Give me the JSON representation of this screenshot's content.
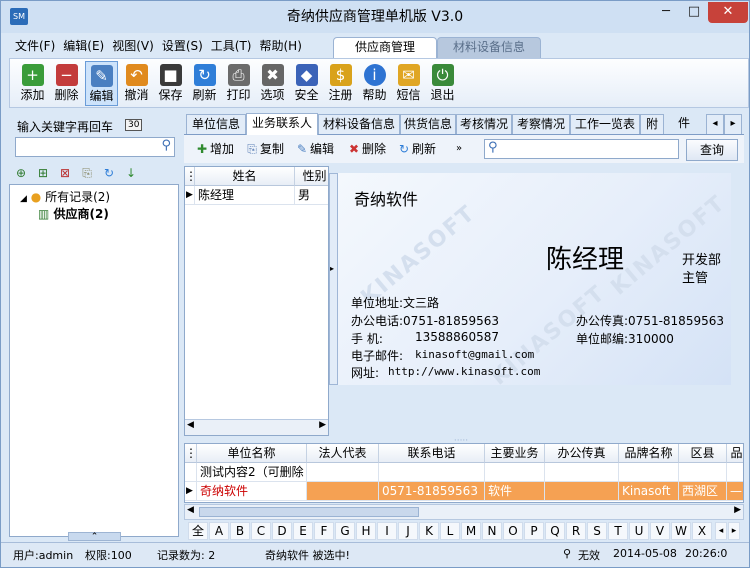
{
  "window": {
    "title": "奇纳供应商管理单机版 V3.0",
    "icon_text": "SM",
    "minimize": "─",
    "maximize": "□",
    "close": "✕"
  },
  "menu": [
    "文件(F)",
    "编辑(E)",
    "视图(V)",
    "设置(S)",
    "工具(T)",
    "帮助(H)"
  ],
  "ribbon_tabs": [
    "供应商管理",
    "材料设备信息"
  ],
  "toolbar": [
    {
      "label": "添加",
      "icon": "+",
      "color": "#3a9c3a"
    },
    {
      "label": "删除",
      "icon": "−",
      "color": "#c33c3c"
    },
    {
      "label": "编辑",
      "icon": "✎",
      "color": "#4a7fc1"
    },
    {
      "label": "撤消",
      "icon": "↶",
      "color": "#e08a1e"
    },
    {
      "label": "保存",
      "icon": "■",
      "color": "#3a3a3a"
    },
    {
      "label": "刷新",
      "icon": "↻",
      "color": "#2f7ed8"
    },
    {
      "label": "打印",
      "icon": "⎙",
      "color": "#6b6b6b"
    },
    {
      "label": "选项",
      "icon": "✖",
      "color": "#666666"
    },
    {
      "label": "安全",
      "icon": "◆",
      "color": "#3b63b8"
    },
    {
      "label": "注册",
      "icon": "$",
      "color": "#d9a21b"
    },
    {
      "label": "帮助",
      "icon": "i",
      "color": "#2e73d2"
    },
    {
      "label": "短信",
      "icon": "✉",
      "color": "#e0a624"
    },
    {
      "label": "退出",
      "icon": "⏻",
      "color": "#3a8a3a"
    }
  ],
  "left": {
    "search_label": "输入关键字再回车",
    "search_badge": "30",
    "search_value": "",
    "tools": [
      "⊕",
      "⊞",
      "⊠",
      "⎘",
      "↻",
      "↓"
    ],
    "tree_root": "所有记录(2)",
    "tree_child": "供应商(2)"
  },
  "detail_tabs": [
    "单位信息",
    "业务联系人",
    "材料设备信息",
    "供货信息",
    "考核情况",
    "考察情况",
    "工作一览表",
    "附",
    "件"
  ],
  "detail_toolbar": {
    "add": "增加",
    "copy": "复制",
    "edit": "编辑",
    "delete": "删除",
    "refresh": "刷新",
    "search_value": "",
    "query": "查询"
  },
  "contacts": {
    "columns": [
      "姓名",
      "性别"
    ],
    "rows": [
      {
        "name": "陈经理",
        "gender": "男"
      }
    ]
  },
  "card": {
    "company": "奇纳软件",
    "name": "陈经理",
    "dept": "开发部",
    "title": "主管",
    "address": "单位地址:文三路",
    "phone": "办公电话:0751-81859563",
    "fax": "办公传真:0751-81859563",
    "mobile_label": "手    机:",
    "mobile": "13588860587",
    "zip": "单位邮编:310000",
    "email_label": "电子邮件:",
    "email": "kinasoft@gmail.com",
    "web_label": "网址:",
    "web": "http://www.kinasoft.com",
    "watermark": "KINASOFT"
  },
  "suppliers": {
    "columns": [
      "单位名称",
      "法人代表",
      "联系电话",
      "主要业务",
      "办公传真",
      "品牌名称",
      "区县",
      "品"
    ],
    "rows": [
      {
        "name": "测试内容2（可删除",
        "rep": "",
        "phone": "",
        "biz": "",
        "fax": "",
        "brand": "",
        "district": "",
        "extra": ""
      },
      {
        "name": "奇纳软件",
        "rep": "",
        "phone": "0571-81859563",
        "biz": "软件",
        "fax": "",
        "brand": "Kinasoft",
        "district": "西湖区",
        "extra": "—"
      }
    ]
  },
  "alphabet": [
    "全",
    "A",
    "B",
    "C",
    "D",
    "E",
    "F",
    "G",
    "H",
    "I",
    "J",
    "K",
    "L",
    "M",
    "N",
    "O",
    "P",
    "Q",
    "R",
    "S",
    "T",
    "U",
    "V",
    "W",
    "X"
  ],
  "status": {
    "user": "用户:admin",
    "perm": "权限:100",
    "count": "记录数为: 2",
    "selected": "奇纳软件 被选中!",
    "state": "无效",
    "date": "2014-05-08",
    "time": "20:26:0"
  },
  "colors": {
    "accent": "#f5a153",
    "selected_text": "#cc0000"
  }
}
